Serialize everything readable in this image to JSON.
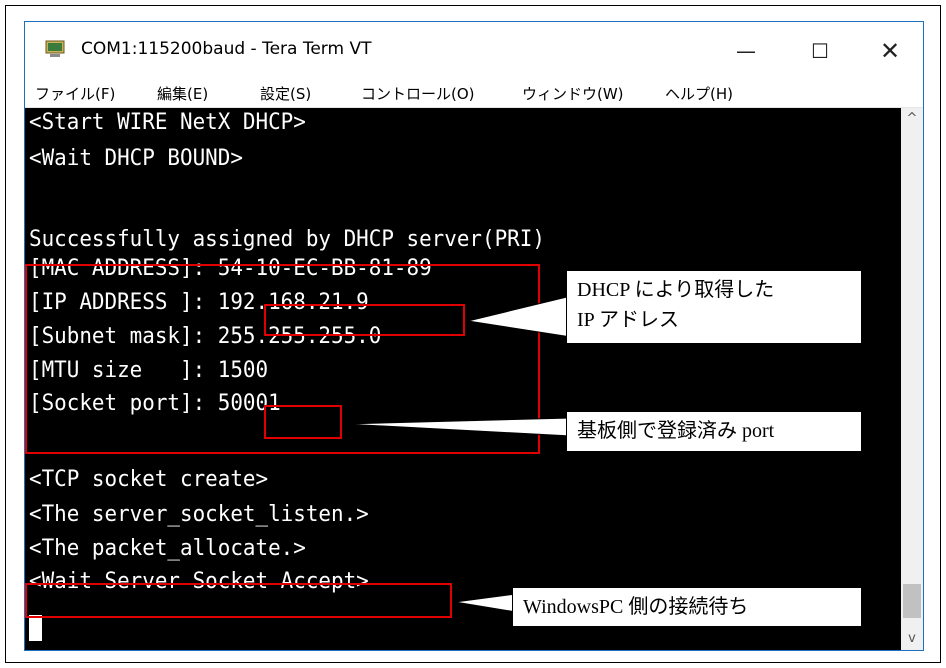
{
  "window": {
    "title": "COM1:115200baud - Tera Term VT",
    "controls": {
      "minimize": "—",
      "maximize": "☐",
      "close": "✕"
    }
  },
  "menu": [
    {
      "label": "ファイル(F)"
    },
    {
      "label": "編集(E)"
    },
    {
      "label": "設定(S)"
    },
    {
      "label": "コントロール(O)"
    },
    {
      "label": "ウィンドウ(W)"
    },
    {
      "label": "ヘルプ(H)"
    }
  ],
  "terminal": {
    "lines": [
      "<Start WIRE NetX DHCP>",
      "<Wait DHCP BOUND>",
      "",
      "Successfully assigned by DHCP server(PRI)",
      "[MAC ADDRESS]: 54-10-EC-BB-81-89",
      "[IP ADDRESS ]: 192.168.21.9",
      "[Subnet mask]: 255.255.255.0",
      "[MTU size   ]: 1500",
      "[Socket port]: 50001",
      "",
      "<TCP socket create>",
      "<The server_socket_listen.>",
      "<The packet_allocate.>",
      "<Wait Server Socket Accept>"
    ]
  },
  "scrollbar": {
    "up": "^",
    "down": "v"
  },
  "callouts": {
    "dhcp": "DHCP により取得した\nIP アドレス",
    "port": "基板側で登録済み port",
    "wait": "WindowsPC 側の接続待ち"
  },
  "colors": {
    "terminal_bg": "#000000",
    "terminal_fg": "#ffffff",
    "highlight": "#e00000",
    "window_border": "#1e6fbd"
  }
}
